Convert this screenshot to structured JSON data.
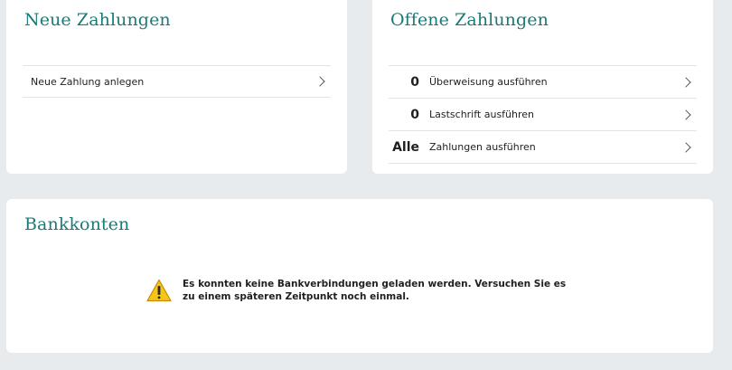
{
  "neue_zahlungen": {
    "title": "Neue Zahlungen",
    "items": [
      {
        "label": "Neue Zahlung anlegen"
      }
    ]
  },
  "offene_zahlungen": {
    "title": "Offene Zahlungen",
    "items": [
      {
        "count": "0",
        "label": "Überweisung ausführen"
      },
      {
        "count": "0",
        "label": "Lastschrift ausführen"
      },
      {
        "count": "Alle",
        "label": "Zahlungen ausführen"
      }
    ]
  },
  "bankkonten": {
    "title": "Bankkonten",
    "message": "Es konnten keine Bankverbindungen geladen werden. Versuchen Sie es zu einem späteren Zeitpunkt noch einmal.",
    "icon": "warning-icon"
  },
  "colors": {
    "accent": "#1a7a77",
    "background": "#e8ebee",
    "warning": "#f5c518"
  }
}
